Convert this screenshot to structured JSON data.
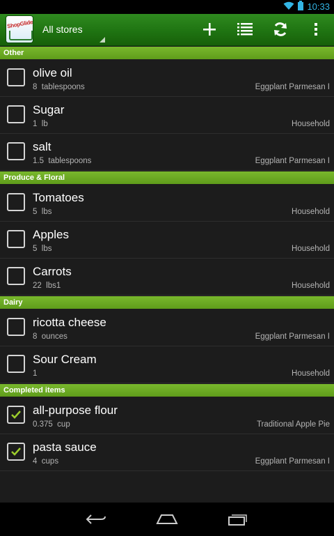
{
  "status": {
    "time": "10:33",
    "wifi_icon": "wifi-icon",
    "battery_icon": "battery-icon"
  },
  "actionbar": {
    "logo_text": "ShopGlider",
    "store_filter": "All stores",
    "icons": [
      "add-icon",
      "list-icon",
      "refresh-icon",
      "overflow-menu-icon"
    ]
  },
  "sections": [
    {
      "title": "Other",
      "items": [
        {
          "name": "olive oil",
          "qty": "8  tablespoons",
          "recipe": "Eggplant Parmesan I",
          "checked": false
        },
        {
          "name": "Sugar",
          "qty": "1  lb",
          "recipe": "Household",
          "checked": false
        },
        {
          "name": "salt",
          "qty": "1.5  tablespoons",
          "recipe": "Eggplant Parmesan I",
          "checked": false
        }
      ]
    },
    {
      "title": "Produce & Floral",
      "items": [
        {
          "name": "Tomatoes",
          "qty": "5  lbs",
          "recipe": "Household",
          "checked": false
        },
        {
          "name": "Apples",
          "qty": "5  lbs",
          "recipe": "Household",
          "checked": false
        },
        {
          "name": "Carrots",
          "qty": "22  lbs1",
          "recipe": "Household",
          "checked": false
        }
      ]
    },
    {
      "title": "Dairy",
      "items": [
        {
          "name": "ricotta cheese",
          "qty": "8  ounces",
          "recipe": "Eggplant Parmesan I",
          "checked": false
        },
        {
          "name": "Sour Cream",
          "qty": "1",
          "recipe": "Household",
          "checked": false
        }
      ]
    },
    {
      "title": "Completed items",
      "items": [
        {
          "name": "all-purpose flour",
          "qty": "0.375  cup",
          "recipe": "Traditional Apple Pie",
          "checked": true
        },
        {
          "name": "pasta sauce",
          "qty": "4  cups",
          "recipe": "Eggplant Parmesan I",
          "checked": true
        }
      ]
    }
  ],
  "navbar": {
    "icons": [
      "back-icon",
      "home-icon",
      "recent-apps-icon"
    ]
  },
  "colors": {
    "actionbar": "#1f7412",
    "section_header": "#6aa822",
    "checkmark": "#9ccc2c",
    "background": "#1c1c1c",
    "status_accent": "#33b5e5"
  }
}
